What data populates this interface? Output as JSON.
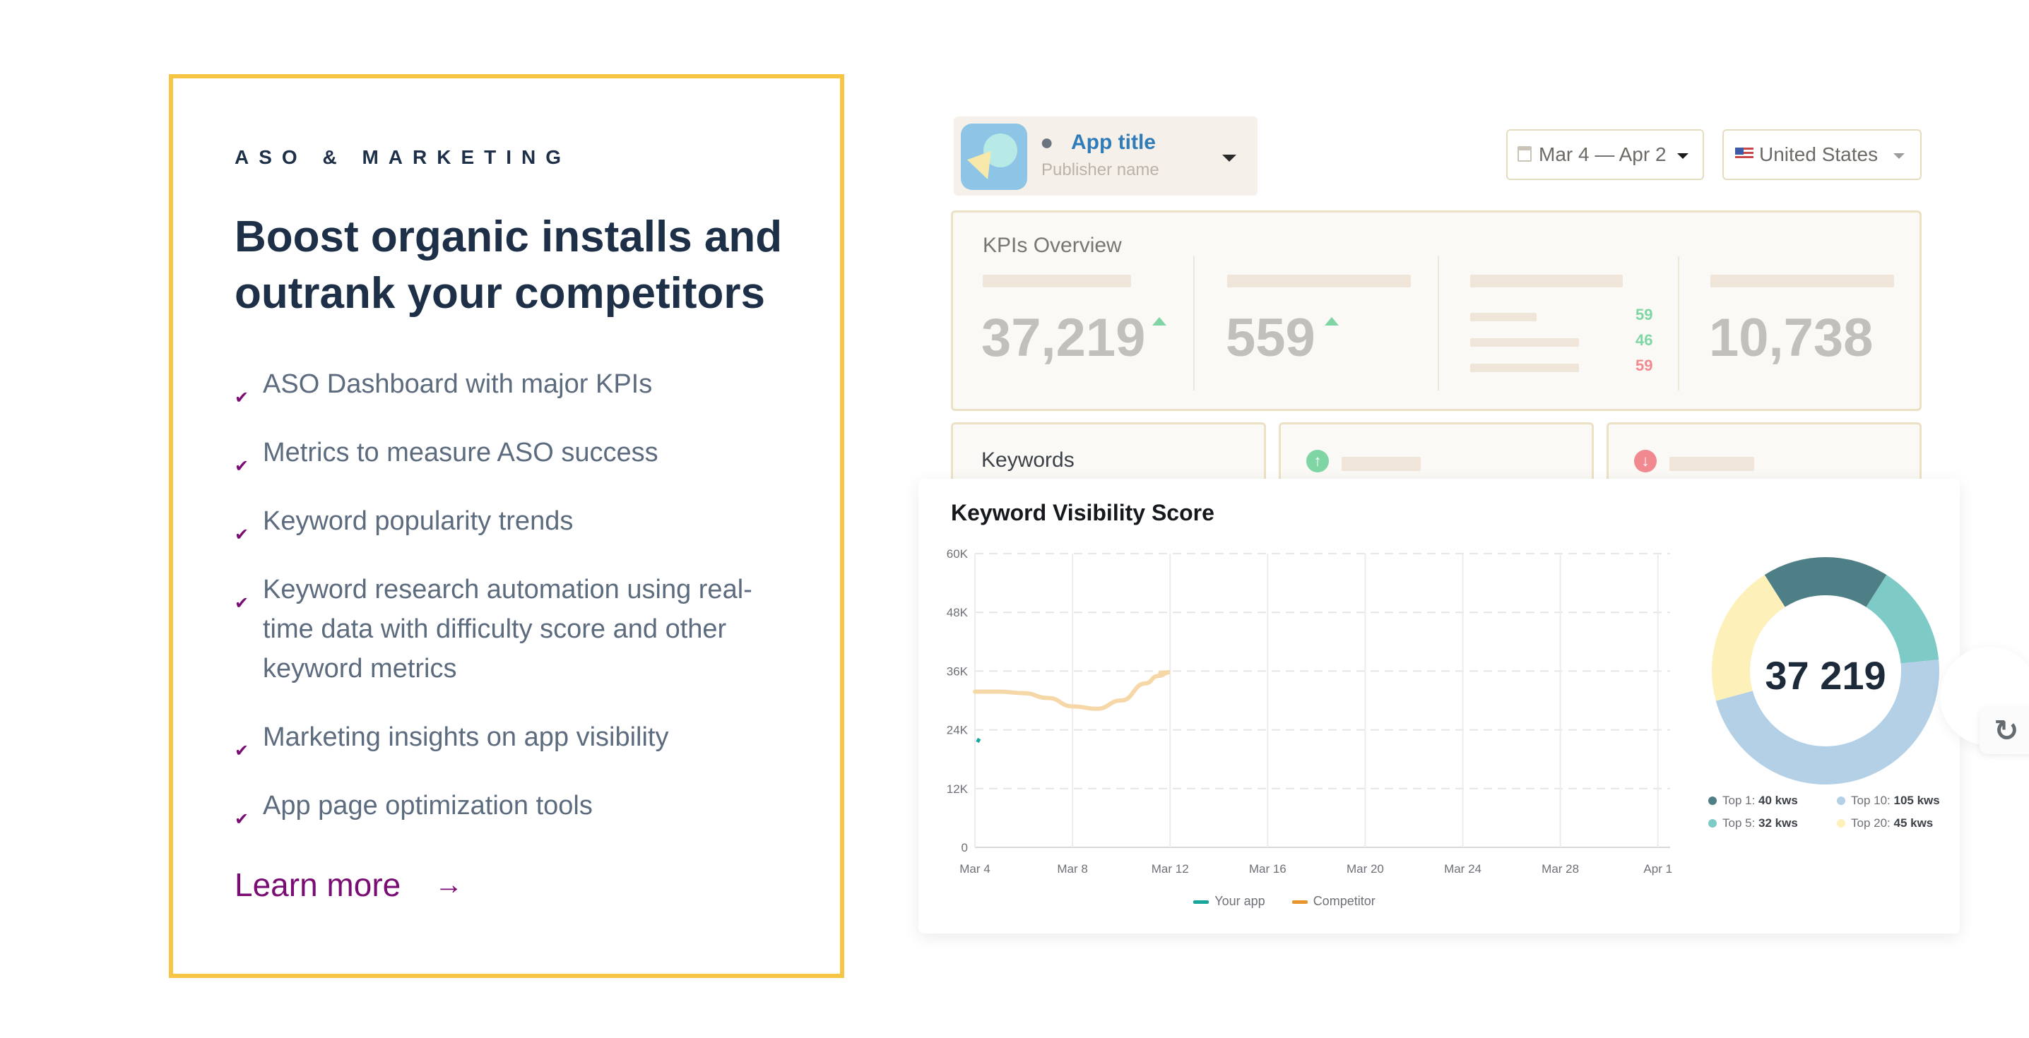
{
  "promo": {
    "eyebrow": "ASO & MARKETING",
    "headline": "Boost organic installs and outrank your competitors",
    "features": [
      "ASO Dashboard with major KPIs",
      "Metrics to measure ASO success",
      "Keyword popularity trends",
      "Keyword research automation using real-time data with difficulty score and other keyword metrics",
      "Marketing insights on app visibility",
      "App page optimization tools"
    ],
    "check_glyph": "✔",
    "learn_more": "Learn more",
    "arrow_glyph": "→"
  },
  "app_selector": {
    "title": "App title",
    "publisher": "Publisher name",
    "apple_glyph": ""
  },
  "date_range": "Mar 4 — Apr 2",
  "country": "United States",
  "kpis": {
    "title": "KPIs Overview",
    "visibility": "37,219",
    "installs": "559",
    "mini_values": [
      "59",
      "46",
      "59"
    ],
    "rating": "10,738"
  },
  "keywords_card": {
    "title": "Keywords"
  },
  "keyword_visibility": {
    "title": "Keyword Visibility Score",
    "total": "37 219",
    "legend": [
      {
        "label": "Top 1:",
        "value": "40 kws",
        "color": "#4f7f86"
      },
      {
        "label": "Top 10:",
        "value": "105 kws",
        "color": "#b3d0e6"
      },
      {
        "label": "Top 5:",
        "value": "32 kws",
        "color": "#7ecac7"
      },
      {
        "label": "Top 20:",
        "value": "45 kws",
        "color": "#fdf0b8"
      }
    ]
  },
  "chart_data": {
    "type": "line",
    "title": "Keyword Visibility Score",
    "x_ticks": [
      "Mar 4",
      "Mar 8",
      "Mar 12",
      "Mar 16",
      "Mar 20",
      "Mar 24",
      "Mar 28",
      "Apr 1"
    ],
    "y_ticks": [
      "0",
      "12K",
      "24K",
      "36K",
      "48K",
      "60K"
    ],
    "ylim": [
      0,
      60000
    ],
    "xlim_days": [
      0,
      28.5
    ],
    "series": [
      {
        "name": "Your app",
        "color": "#1aa79b",
        "points": [
          [
            0.1,
            21500
          ],
          [
            0.18,
            22200
          ]
        ]
      },
      {
        "name": "Competitor",
        "color": "#f6d8a8",
        "points": [
          [
            0,
            31800
          ],
          [
            1,
            31800
          ],
          [
            2,
            31500
          ],
          [
            3,
            30500
          ],
          [
            4,
            28800
          ],
          [
            5,
            28300
          ],
          [
            6,
            30000
          ],
          [
            7,
            33500
          ],
          [
            7.5,
            35000
          ],
          [
            8,
            35800
          ],
          [
            7.6,
            35600
          ]
        ]
      }
    ],
    "donut": {
      "segments": [
        {
          "label": "Top 1",
          "value": 40,
          "color": "#4f7f86"
        },
        {
          "label": "Top 5",
          "value": 32,
          "color": "#7ecac7"
        },
        {
          "label": "Top 10",
          "value": 105,
          "color": "#b3d0e6"
        },
        {
          "label": "Top 20",
          "value": 45,
          "color": "#fdf0b8"
        }
      ]
    }
  }
}
